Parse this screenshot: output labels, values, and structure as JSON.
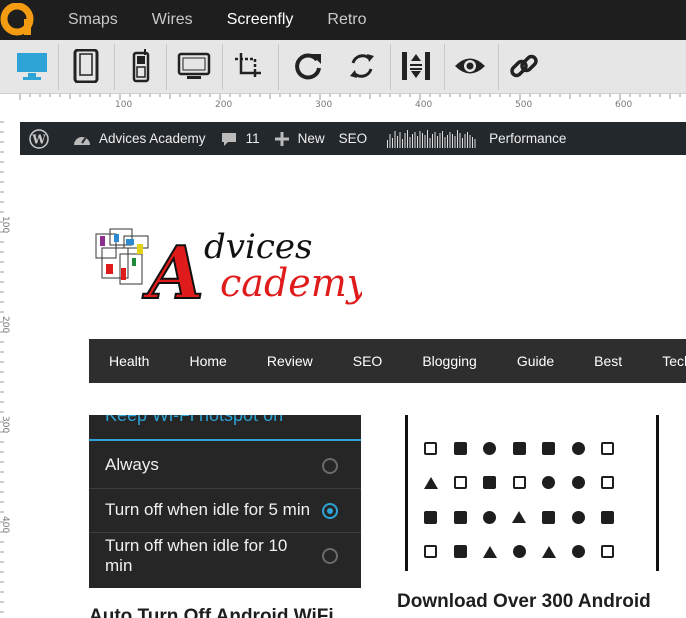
{
  "app": {
    "nav": [
      "Smaps",
      "Wires",
      "Screenfly",
      "Retro"
    ],
    "active_nav": "Screenfly",
    "toolbar_icons": [
      "desktop-icon",
      "tablet-icon",
      "mobile-icon",
      "tv-icon",
      "crop-icon",
      "rotate-icon",
      "refresh-icon",
      "scroll-icon",
      "eye-icon",
      "link-icon"
    ],
    "ruler_top": [
      "100",
      "200",
      "300",
      "400",
      "500",
      "600"
    ],
    "ruler_left": [
      "100",
      "200",
      "300",
      "400"
    ],
    "accent": "#2ea3d6"
  },
  "site": {
    "adminbar": {
      "site_name": "Advices Academy",
      "comments": "11",
      "new_label": "New",
      "seo_label": "SEO",
      "performance_label": "Performance"
    },
    "logo": {
      "line1": "dvices",
      "line2": "cademy",
      "big_letter": "A"
    },
    "nav": [
      "Health",
      "Home",
      "Review",
      "SEO",
      "Blogging",
      "Guide",
      "Best",
      "Tech"
    ],
    "card1": {
      "header": "Keep Wi-Fi hotspot on",
      "options": [
        "Always",
        "Turn off when idle for 5 min",
        "Turn off when idle for 10 min"
      ],
      "selected_index": 1
    },
    "post_titles": [
      "Auto Turn Off Android WiFi",
      "Download Over 300 Android"
    ]
  }
}
